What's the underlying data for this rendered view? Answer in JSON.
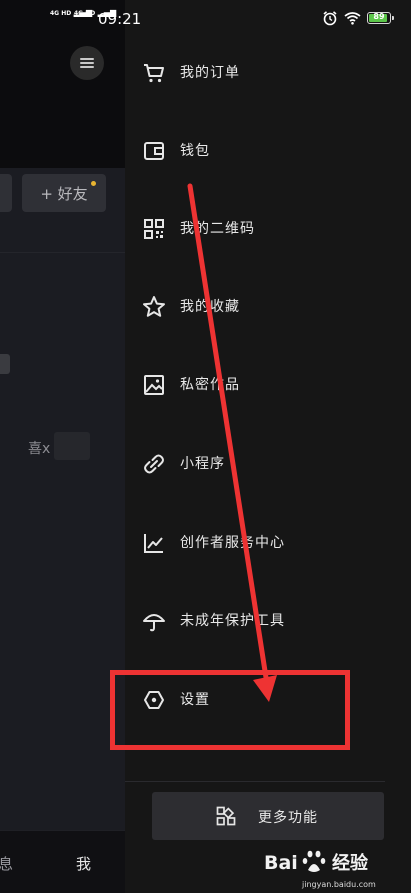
{
  "status_bar": {
    "network_1": "4G HD",
    "network_2": "4G HD",
    "time": "09:21",
    "battery_level": "89",
    "battery_color": "#5cc64a"
  },
  "background_page": {
    "add_friend_label": "+ 好友",
    "like_text": "喜x",
    "tab_messages": "息",
    "tab_me": "我",
    "notification_dot_color": "#e8b431"
  },
  "drawer": {
    "items": [
      {
        "label": "我的订单",
        "icon": "cart-icon"
      },
      {
        "label": "钱包",
        "icon": "wallet-icon"
      },
      {
        "label": "我的二维码",
        "icon": "qrcode-icon"
      },
      {
        "label": "我的收藏",
        "icon": "star-icon"
      },
      {
        "label": "私密作品",
        "icon": "image-icon"
      },
      {
        "label": "小程序",
        "icon": "link-icon"
      },
      {
        "label": "创作者服务中心",
        "icon": "chart-icon"
      },
      {
        "label": "未成年保护工具",
        "icon": "umbrella-icon"
      },
      {
        "label": "设置",
        "icon": "hexagon-settings-icon"
      }
    ],
    "more_button_label": "更多功能"
  },
  "annotation": {
    "highlight_color": "#ee3333"
  },
  "watermark": {
    "brand": "Bai 经验",
    "site": "jingyan.baidu.com"
  }
}
